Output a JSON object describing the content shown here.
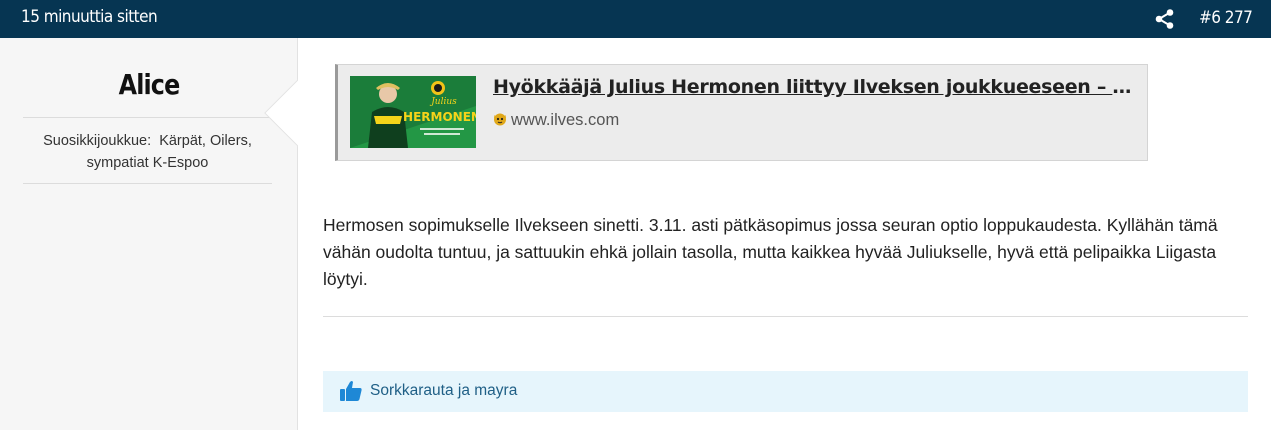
{
  "header": {
    "timestamp": "15 minuuttia sitten",
    "share_icon": "share-icon",
    "post_number": "#6 277"
  },
  "author": {
    "name": "Alice",
    "favorite_label": "Suosikkijoukkue:",
    "favorite_teams": "Kärpät, Oilers, sympatiat K-Espoo"
  },
  "link_preview": {
    "title": "Hyökkääjä Julius Hermonen liittyy Ilveksen joukkueeseen – Tam...",
    "site": "www.ilves.com",
    "thumbnail_text_top": "Julius",
    "thumbnail_text_main": "HERMONEN"
  },
  "post": {
    "text": "Hermosen sopimukselle Ilvekseen sinetti. 3.11. asti pätkäsopimus jossa seuran optio loppukaudesta. Kyllähän tämä vähän oudolta tuntuu, ja sattuukin ehkä jollain tasolla, mutta kaikkea hyvää Juliukselle, hyvä että pelipaikka Liigasta löytyi."
  },
  "likes": {
    "icon": "thumbs-up-icon",
    "names": "Sorkkarauta ja mayra"
  },
  "colors": {
    "header_bg": "#063552",
    "likes_bg": "#e6f5fc",
    "like_accent": "#1e88d6"
  }
}
